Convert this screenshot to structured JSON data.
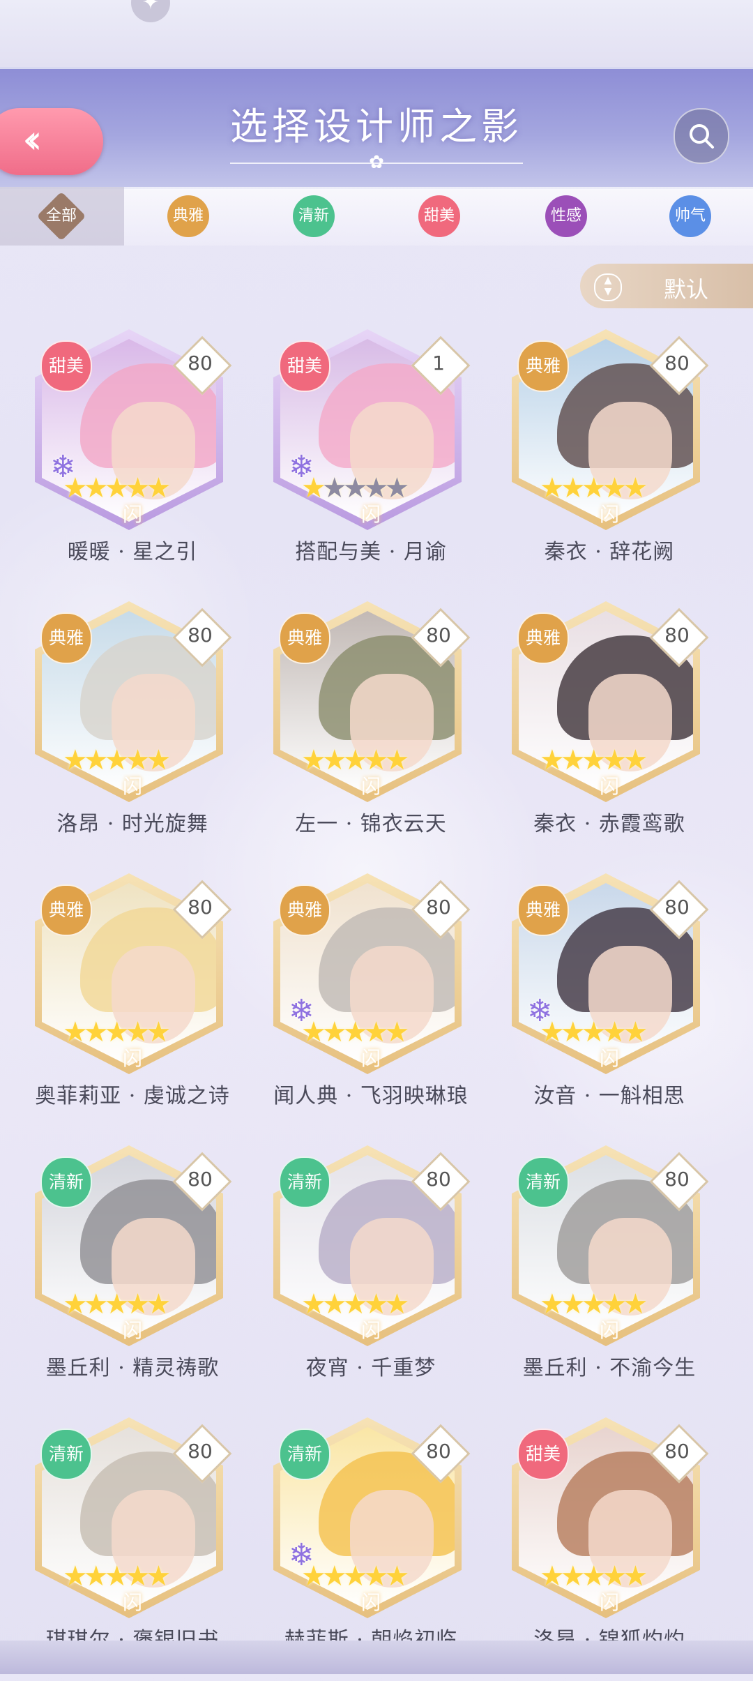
{
  "header": {
    "title": "选择设计师之影"
  },
  "tabs": [
    {
      "label": "全部",
      "color": "#9a7a68",
      "selected": true
    },
    {
      "label": "典雅",
      "color": "#e0a24a"
    },
    {
      "label": "清新",
      "color": "#4cc28e"
    },
    {
      "label": "甜美",
      "color": "#f0697d"
    },
    {
      "label": "性感",
      "color": "#9b4fb8"
    },
    {
      "label": "帅气",
      "color": "#5b8fe6"
    }
  ],
  "sort": {
    "label": "默认"
  },
  "flash_label": "闪",
  "cards": [
    {
      "name": "暖暖 · 星之引",
      "type": "甜美",
      "level": "80",
      "stars": 5,
      "hair": "#f2a6c6",
      "bg": "#d9b8e8",
      "frame": "purple",
      "snow": true
    },
    {
      "name": "搭配与美 · 月谕",
      "type": "甜美",
      "level": "1",
      "stars": 1,
      "hair": "#f4a9c8",
      "bg": "#d8bbe6",
      "frame": "purple",
      "snow": true
    },
    {
      "name": "秦衣 · 辞花阙",
      "type": "典雅",
      "level": "80",
      "stars": 5,
      "hair": "#5c4a4a",
      "bg": "#b9d2e8",
      "frame": "gold",
      "snow": false
    },
    {
      "name": "洛昂 · 时光旋舞",
      "type": "典雅",
      "level": "80",
      "stars": 5,
      "hair": "#d7d3cc",
      "bg": "#c7dbe9",
      "frame": "gold",
      "snow": false
    },
    {
      "name": "左一 · 锦衣云天",
      "type": "典雅",
      "level": "80",
      "stars": 5,
      "hair": "#8a8c6c",
      "bg": "#c2b9b5",
      "frame": "gold",
      "snow": false
    },
    {
      "name": "秦衣 · 赤霞鸾歌",
      "type": "典雅",
      "level": "80",
      "stars": 5,
      "hair": "#3d3238",
      "bg": "#e9dfe4",
      "frame": "gold",
      "snow": false
    },
    {
      "name": "奥菲莉亚 · 虔诚之诗",
      "type": "典雅",
      "level": "80",
      "stars": 5,
      "hair": "#f1d795",
      "bg": "#efe3c2",
      "frame": "gold",
      "snow": false
    },
    {
      "name": "闻人典 · 飞羽映琳琅",
      "type": "典雅",
      "level": "80",
      "stars": 5,
      "hair": "#bfb9b4",
      "bg": "#f0e2cf",
      "frame": "gold",
      "snow": true
    },
    {
      "name": "汝音 · 一斛相思",
      "type": "典雅",
      "level": "80",
      "stars": 5,
      "hair": "#3f3340",
      "bg": "#c9d8ea",
      "frame": "gold",
      "snow": true
    },
    {
      "name": "墨丘利 · 精灵祷歌",
      "type": "清新",
      "level": "80",
      "stars": 5,
      "hair": "#8f8d92",
      "bg": "#d4d5dc",
      "frame": "gold",
      "snow": false
    },
    {
      "name": "夜宵 · 千重梦",
      "type": "清新",
      "level": "80",
      "stars": 5,
      "hair": "#b7adc7",
      "bg": "#e5e3ea",
      "frame": "gold",
      "snow": false
    },
    {
      "name": "墨丘利 · 不渝今生",
      "type": "清新",
      "level": "80",
      "stars": 5,
      "hair": "#9c9a98",
      "bg": "#dcdfe4",
      "frame": "gold",
      "snow": false
    },
    {
      "name": "琪琪尔 · 褒银旧书",
      "type": "清新",
      "level": "80",
      "stars": 5,
      "hair": "#c5bdb2",
      "bg": "#e6e1dc",
      "frame": "gold",
      "snow": false
    },
    {
      "name": "赫菲斯 · 朝焰初临",
      "type": "清新",
      "level": "80",
      "stars": 5,
      "hair": "#f4c04c",
      "bg": "#fae6a6",
      "frame": "gold",
      "snow": true
    },
    {
      "name": "洛昂 · 锦狐灼灼",
      "type": "甜美",
      "level": "80",
      "stars": 5,
      "hair": "#b57b5a",
      "bg": "#e8d4cf",
      "frame": "gold",
      "snow": false
    }
  ],
  "type_colors": {
    "甜美": "#f0697d",
    "典雅": "#e0a24a",
    "清新": "#4cc28e"
  }
}
